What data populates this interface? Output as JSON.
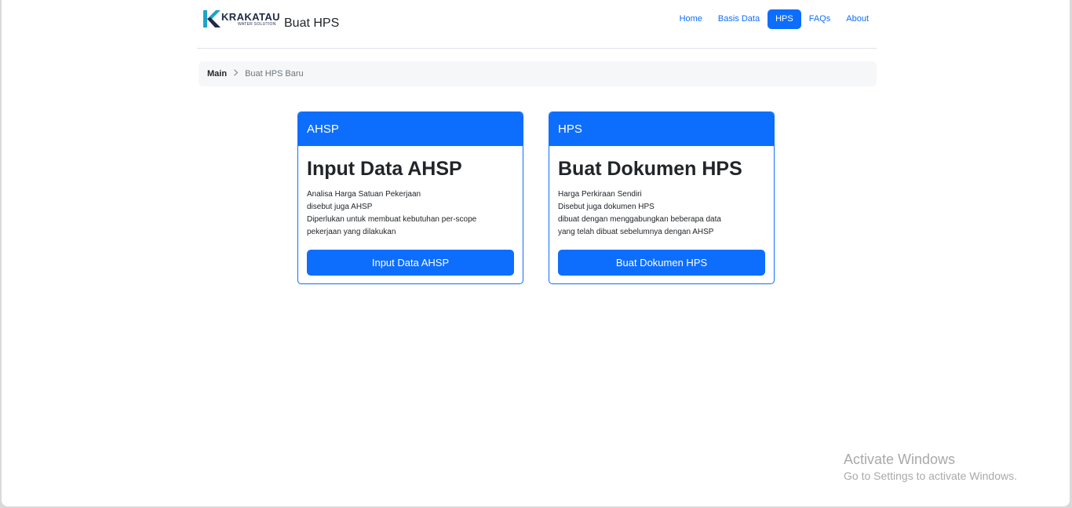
{
  "brand": {
    "logo_name": "KRAKATAU",
    "logo_sub": "WATER SOLUTION",
    "page_title": "Buat HPS"
  },
  "nav": {
    "items": [
      {
        "label": "Home"
      },
      {
        "label": "Basis Data"
      },
      {
        "label": "HPS"
      },
      {
        "label": "FAQs"
      },
      {
        "label": "About"
      }
    ],
    "active": "HPS"
  },
  "breadcrumb": {
    "main": "Main",
    "current": "Buat HPS Baru"
  },
  "cards": [
    {
      "header": "AHSP",
      "title": "Input Data AHSP",
      "lines": [
        "Analisa Harga Satuan Pekerjaan",
        "disebut juga AHSP",
        "Diperlukan untuk membuat kebutuhan per-scope",
        "pekerjaan yang dilakukan"
      ],
      "button": "Input Data AHSP"
    },
    {
      "header": "HPS",
      "title": "Buat Dokumen HPS",
      "lines": [
        "Harga Perkiraan Sendiri",
        "Disebut juga dokumen HPS",
        "dibuat dengan menggabungkan beberapa data",
        "yang telah dibuat sebelumnya dengan AHSP"
      ],
      "button": "Buat Dokumen HPS"
    }
  ],
  "watermark": {
    "title": "Activate Windows",
    "subtitle": "Go to Settings to activate Windows."
  },
  "colors": {
    "primary": "#0d6efd",
    "breadcrumb_bg": "#f6f7f8",
    "logo_teal": "#1fa3c8"
  }
}
